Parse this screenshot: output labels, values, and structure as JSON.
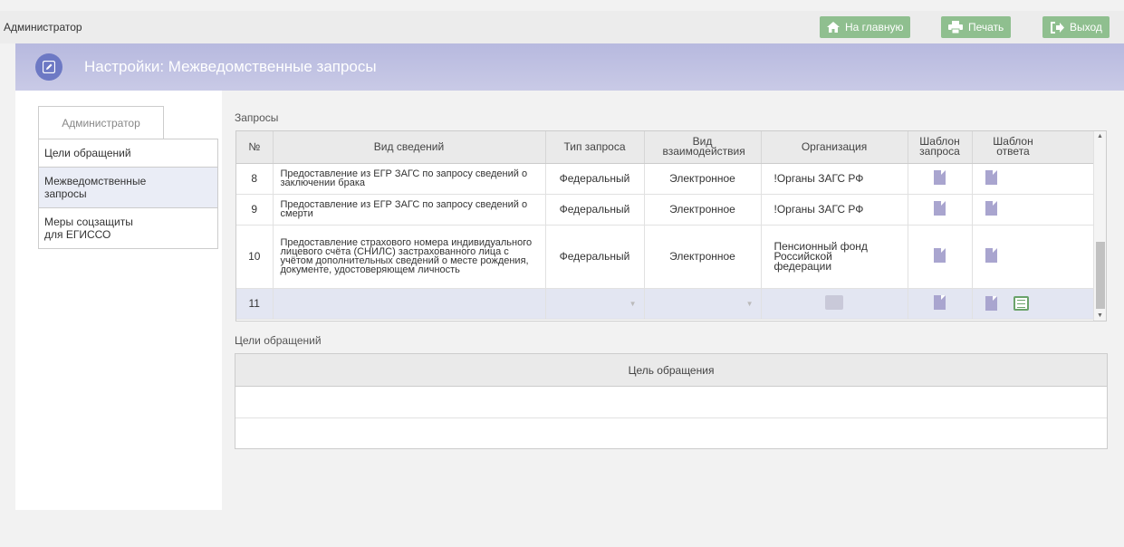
{
  "topbar": {
    "user": "Администратор",
    "home_label": "На главную",
    "print_label": "Печать",
    "exit_label": "Выход"
  },
  "header": {
    "title": "Настройки: Межведомственные запросы"
  },
  "sidebar": {
    "tab_label": "Администратор",
    "items": [
      {
        "label": "Цели обращений"
      },
      {
        "label": "Межведомственные запросы"
      },
      {
        "label": "Меры соцзащиты для ЕГИССО"
      }
    ]
  },
  "requests": {
    "section_label": "Запросы",
    "columns": {
      "num": "№",
      "info": "Вид сведений",
      "type": "Тип запроса",
      "interaction": "Вид взаимодействия",
      "org": "Организация",
      "req_template": "Шаблон запроса",
      "resp_template": "Шаблон ответа"
    },
    "rows": [
      {
        "num": "8",
        "info": "Предоставление из ЕГР ЗАГС по запросу сведений о заключении брака",
        "type": "Федеральный",
        "interaction": "Электронное",
        "org": "!Органы ЗАГС РФ"
      },
      {
        "num": "9",
        "info": "Предоставление из ЕГР ЗАГС по запросу сведений о смерти",
        "type": "Федеральный",
        "interaction": "Электронное",
        "org": "!Органы ЗАГС РФ"
      },
      {
        "num": "10",
        "info": "Предоставление страхового номера индивидуального лицевого счёта (СНИЛС) застрахованного лица с учётом дополнительных сведений о месте рождения, документе, удостоверяющем личность",
        "type": "Федеральный",
        "interaction": "Электронное",
        "org": "Пенсионный фонд Российской федерации"
      },
      {
        "num": "11",
        "info": "",
        "type": "",
        "interaction": "",
        "org": ""
      }
    ]
  },
  "goals": {
    "section_label": "Цели обращений",
    "column": "Цель обращения"
  },
  "colors": {
    "button_green": "#8fbf8f",
    "header_band": "#b7b9df",
    "header_circle": "#6d79c4",
    "doc_icon": "#a9a5cf",
    "selected_row": "#e3e6f2"
  }
}
